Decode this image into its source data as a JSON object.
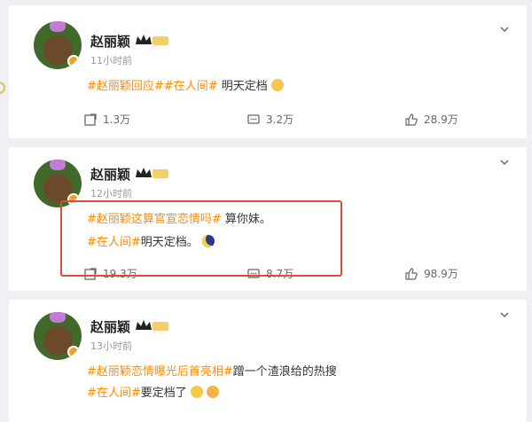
{
  "posts": [
    {
      "author": "赵丽颖",
      "time": "11小时前",
      "lines": [
        {
          "tags": [
            "#赵丽颖回应#",
            "#在人间#"
          ],
          "text": " 明天定档"
        }
      ],
      "actions": {
        "repost": "1.3万",
        "comment": "3.2万",
        "like": "28.9万"
      }
    },
    {
      "author": "赵丽颖",
      "time": "12小时前",
      "lines": [
        {
          "tags": [
            "#赵丽颖这算官宣恋情吗#"
          ],
          "text": " 算你妹。"
        },
        {
          "tags": [
            "#在人间#"
          ],
          "text": "明天定档。"
        }
      ],
      "actions": {
        "repost": "19.3万",
        "comment": "8.7万",
        "like": "98.9万"
      }
    },
    {
      "author": "赵丽颖",
      "time": "13小时前",
      "lines": [
        {
          "tags": [
            "#赵丽颖恋情曝光后首亮相#"
          ],
          "text": "蹭一个渣浪给的热搜"
        },
        {
          "tags": [
            "#在人间#"
          ],
          "text": "要定档了"
        }
      ]
    }
  ],
  "colors": {
    "tag": "#ff8a00",
    "highlight": "#e04a3b"
  }
}
